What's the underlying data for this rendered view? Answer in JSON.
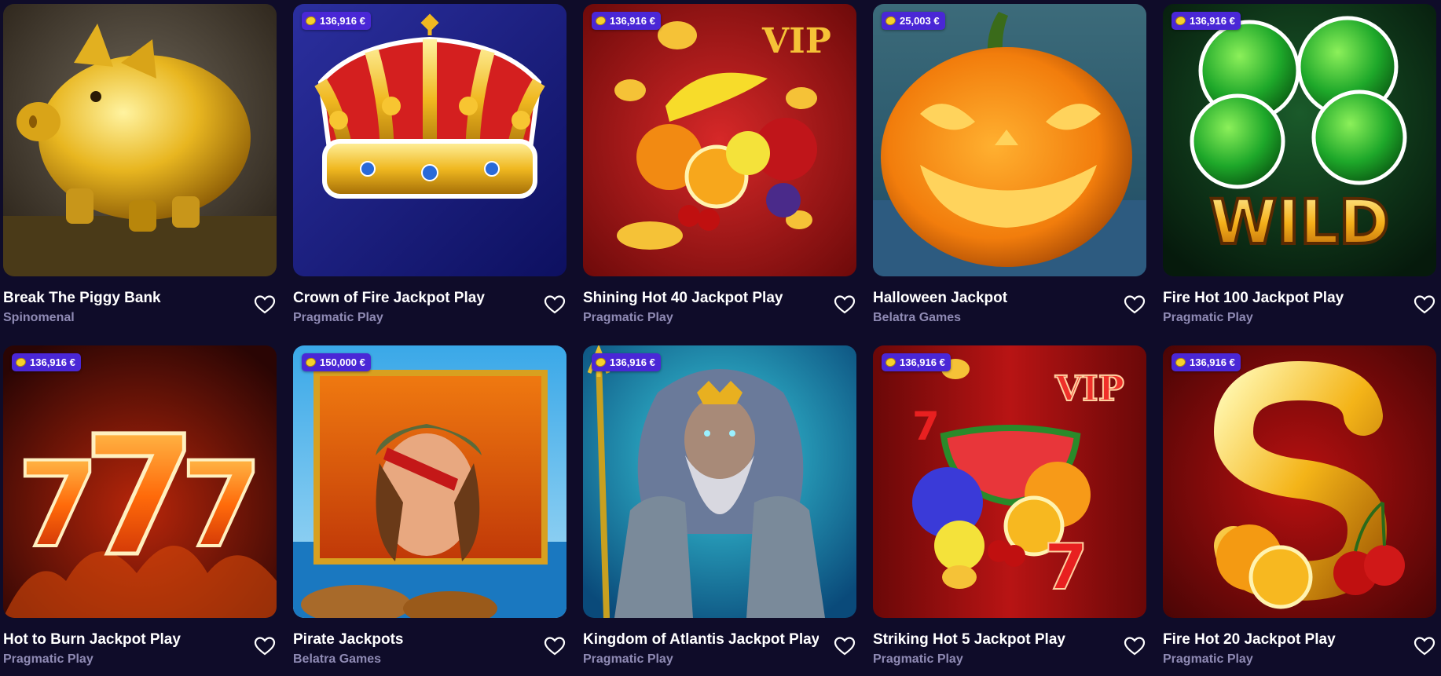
{
  "games": [
    {
      "title": "Break The Piggy Bank",
      "provider": "Spinomenal",
      "jackpot": "",
      "art": "piggy-icon"
    },
    {
      "title": "Crown of Fire Jackpot Play",
      "provider": "Pragmatic Play",
      "jackpot": "136,916 €",
      "art": "crown-icon"
    },
    {
      "title": "Shining Hot 40 Jackpot Play",
      "provider": "Pragmatic Play",
      "jackpot": "136,916 €",
      "art": "fruits-vip-icon"
    },
    {
      "title": "Halloween Jackpot",
      "provider": "Belatra Games",
      "jackpot": "25,003 €",
      "art": "pumpkin-icon"
    },
    {
      "title": "Fire Hot 100 Jackpot Play",
      "provider": "Pragmatic Play",
      "jackpot": "136,916 €",
      "art": "clover-wild-icon"
    },
    {
      "title": "Hot to Burn Jackpot Play",
      "provider": "Pragmatic Play",
      "jackpot": "136,916 €",
      "art": "sevens-icon"
    },
    {
      "title": "Pirate Jackpots",
      "provider": "Belatra Games",
      "jackpot": "150,000 €",
      "art": "pirate-icon"
    },
    {
      "title": "Kingdom of Atlantis Jackpot Play",
      "provider": "Pragmatic Play",
      "jackpot": "136,916 €",
      "art": "poseidon-icon"
    },
    {
      "title": "Striking Hot 5 Jackpot Play",
      "provider": "Pragmatic Play",
      "jackpot": "136,916 €",
      "art": "watermelon-vip-icon"
    },
    {
      "title": "Fire Hot 20 Jackpot Play",
      "provider": "Pragmatic Play",
      "jackpot": "136,916 €",
      "art": "dollar-icon"
    }
  ],
  "art_text": {
    "vip": "VIP",
    "wild": "WILD",
    "seven": "7"
  },
  "colors": {
    "background": "#0f0c29",
    "badge": "#4a27d6",
    "provider_text": "#8f8ab4"
  }
}
